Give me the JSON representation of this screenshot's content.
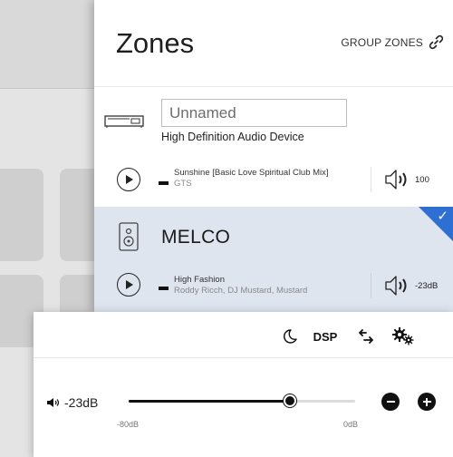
{
  "zones_panel": {
    "title": "Zones",
    "group_zones_label": "GROUP ZONES",
    "zones": [
      {
        "name_placeholder": "Unnamed",
        "device": "High Definition Audio Device",
        "track_title": "Sunshine [Basic Love Spiritual Club Mix]",
        "track_artist": "GTS",
        "volume": "100",
        "selected": false
      },
      {
        "name": "MELCO",
        "track_title": "High Fashion",
        "track_artist": "Roddy Ricch, DJ Mustard, Mustard",
        "volume": "-23dB",
        "selected": true
      }
    ]
  },
  "volume_popup": {
    "tools": [
      "moon-icon",
      "DSP",
      "transfer-icon",
      "settings-icon"
    ],
    "current_volume": "-23dB",
    "slider_min": "-80dB",
    "slider_max": "0dB",
    "slider_fraction": 0.71
  },
  "colors": {
    "accent": "#2d6fd2",
    "selected_zone_bg": "#dfe5ef"
  }
}
